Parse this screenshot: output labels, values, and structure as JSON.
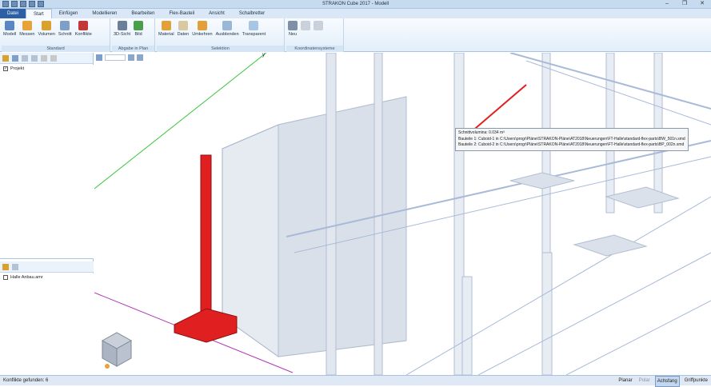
{
  "window": {
    "title": "STRAKON Cube 2017 - Modell"
  },
  "tabs": [
    "Datei",
    "Start",
    "Einfügen",
    "Modellieren",
    "Bearbeiten",
    "Flex-Bauteil",
    "Ansicht",
    "Schalbretter"
  ],
  "ribbon": {
    "groups": [
      {
        "label": "Standard",
        "buttons": [
          "Modell",
          "Messen",
          "Volumen",
          "Schnitt",
          "Konflikte"
        ]
      },
      {
        "label": "Abgabe in Plan",
        "buttons": [
          "3D-Sicht",
          "Bild"
        ]
      },
      {
        "label": "Selektion",
        "buttons": [
          "Material",
          "Daten",
          "Umkehren",
          "Ausblenden",
          "Transparent"
        ]
      },
      {
        "label": "Koordinatensysteme",
        "buttons": [
          "Neu"
        ]
      }
    ]
  },
  "tree_top": {
    "item": "Projekt"
  },
  "tree_bottom": {
    "item": "Halle Anbau.amr"
  },
  "tooltip": {
    "line1": "Schnittvolumina: 0.034 m³",
    "line2": "Bauteile 1: Cuboid-1 in C:\\Users\\progr\\Pläne\\STRAKON-Pläne\\AT2018\\Neuerungen\\FT-Halle\\standard-flex-parts\\BW_501n.smd",
    "line3": "Bauteile 2: Cuboid-2 in C:\\Users\\progr\\Pläne\\STRAKON-Pläne\\AT2018\\Neuerungen\\FT-Halle\\standard-flex-parts\\BP_002n.smd"
  },
  "axis_label": "y",
  "status": {
    "message": "Konflikte gefunden: 6",
    "modes": [
      "Planar",
      "Polar",
      "Achsfang",
      "Griffpunkte"
    ]
  },
  "colors": {
    "conflict": "#e02020",
    "y_axis": "#35c43a",
    "x_axis": "#b03ab8",
    "structure": "#9fb3d4"
  }
}
